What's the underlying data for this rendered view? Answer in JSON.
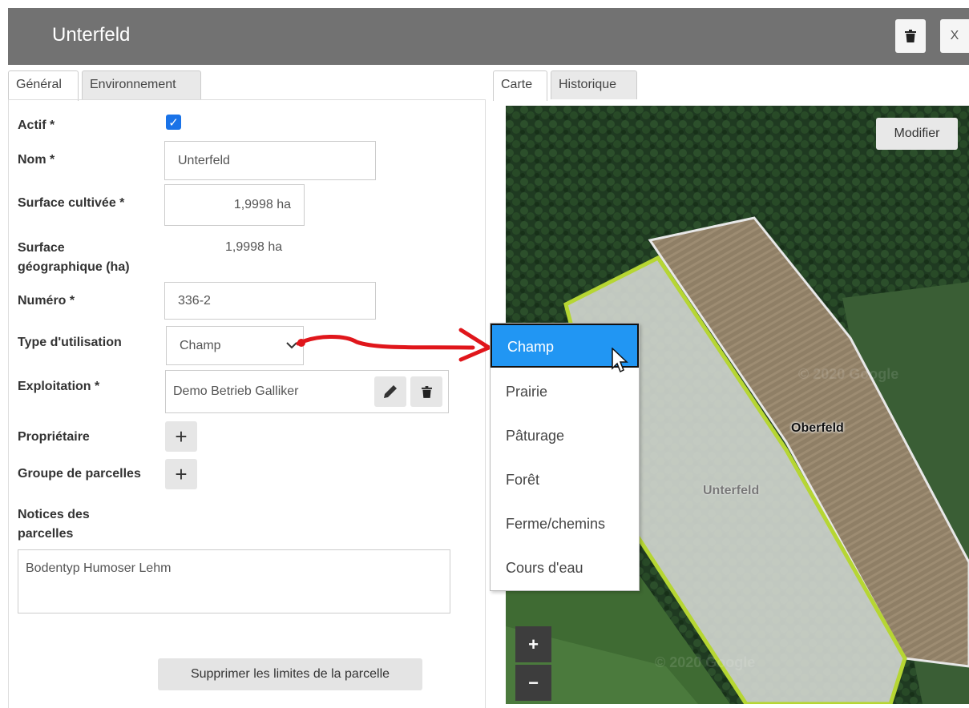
{
  "header": {
    "title": "Unterfeld",
    "close_label": "X"
  },
  "tabs_left": [
    {
      "label": "Général"
    },
    {
      "label": "Environnement"
    }
  ],
  "tabs_right": [
    {
      "label": "Carte"
    },
    {
      "label": "Historique"
    }
  ],
  "form": {
    "actif_label": "Actif *",
    "actif_checked": true,
    "nom_label": "Nom *",
    "nom_value": "Unterfeld",
    "surface_cultivee_label": "Surface cultivée *",
    "surface_cultivee_value": "1,9998 ha",
    "surface_geo_label_line1": "Surface",
    "surface_geo_label_line2": "géographique (ha)",
    "surface_geo_value": "1,9998 ha",
    "numero_label": "Numéro *",
    "numero_value": "336-2",
    "type_label": "Type d'utilisation",
    "type_value": "Champ",
    "exploitation_label": "Exploitation *",
    "exploitation_value": "Demo Betrieb Galliker",
    "proprietaire_label": "Propriétaire",
    "groupe_label": "Groupe de parcelles",
    "notices_label_line1": "Notices des",
    "notices_label_line2": "parcelles",
    "notices_value": "Bodentyp Humoser Lehm",
    "delete_limits_label": "Supprimer les limites de la parcelle"
  },
  "map": {
    "modify_label": "Modifier",
    "zoom_in": "+",
    "zoom_out": "−",
    "label_oberfeld": "Oberfeld",
    "label_unterfeld": "Unterfeld",
    "watermark_1": "© 2020 Google",
    "watermark_2": "© 2020 Google"
  },
  "dropdown": {
    "options": [
      {
        "label": "Champ",
        "selected": true
      },
      {
        "label": "Prairie"
      },
      {
        "label": "Pâturage"
      },
      {
        "label": "Forêt"
      },
      {
        "label": "Ferme/chemins"
      },
      {
        "label": "Cours d'eau"
      }
    ]
  },
  "colors": {
    "header_bg": "#727272",
    "selected_option": "#2196f3",
    "checkbox": "#1a73e8",
    "annotation_arrow": "#e0161b",
    "parcel_outline": "#b6d633"
  }
}
